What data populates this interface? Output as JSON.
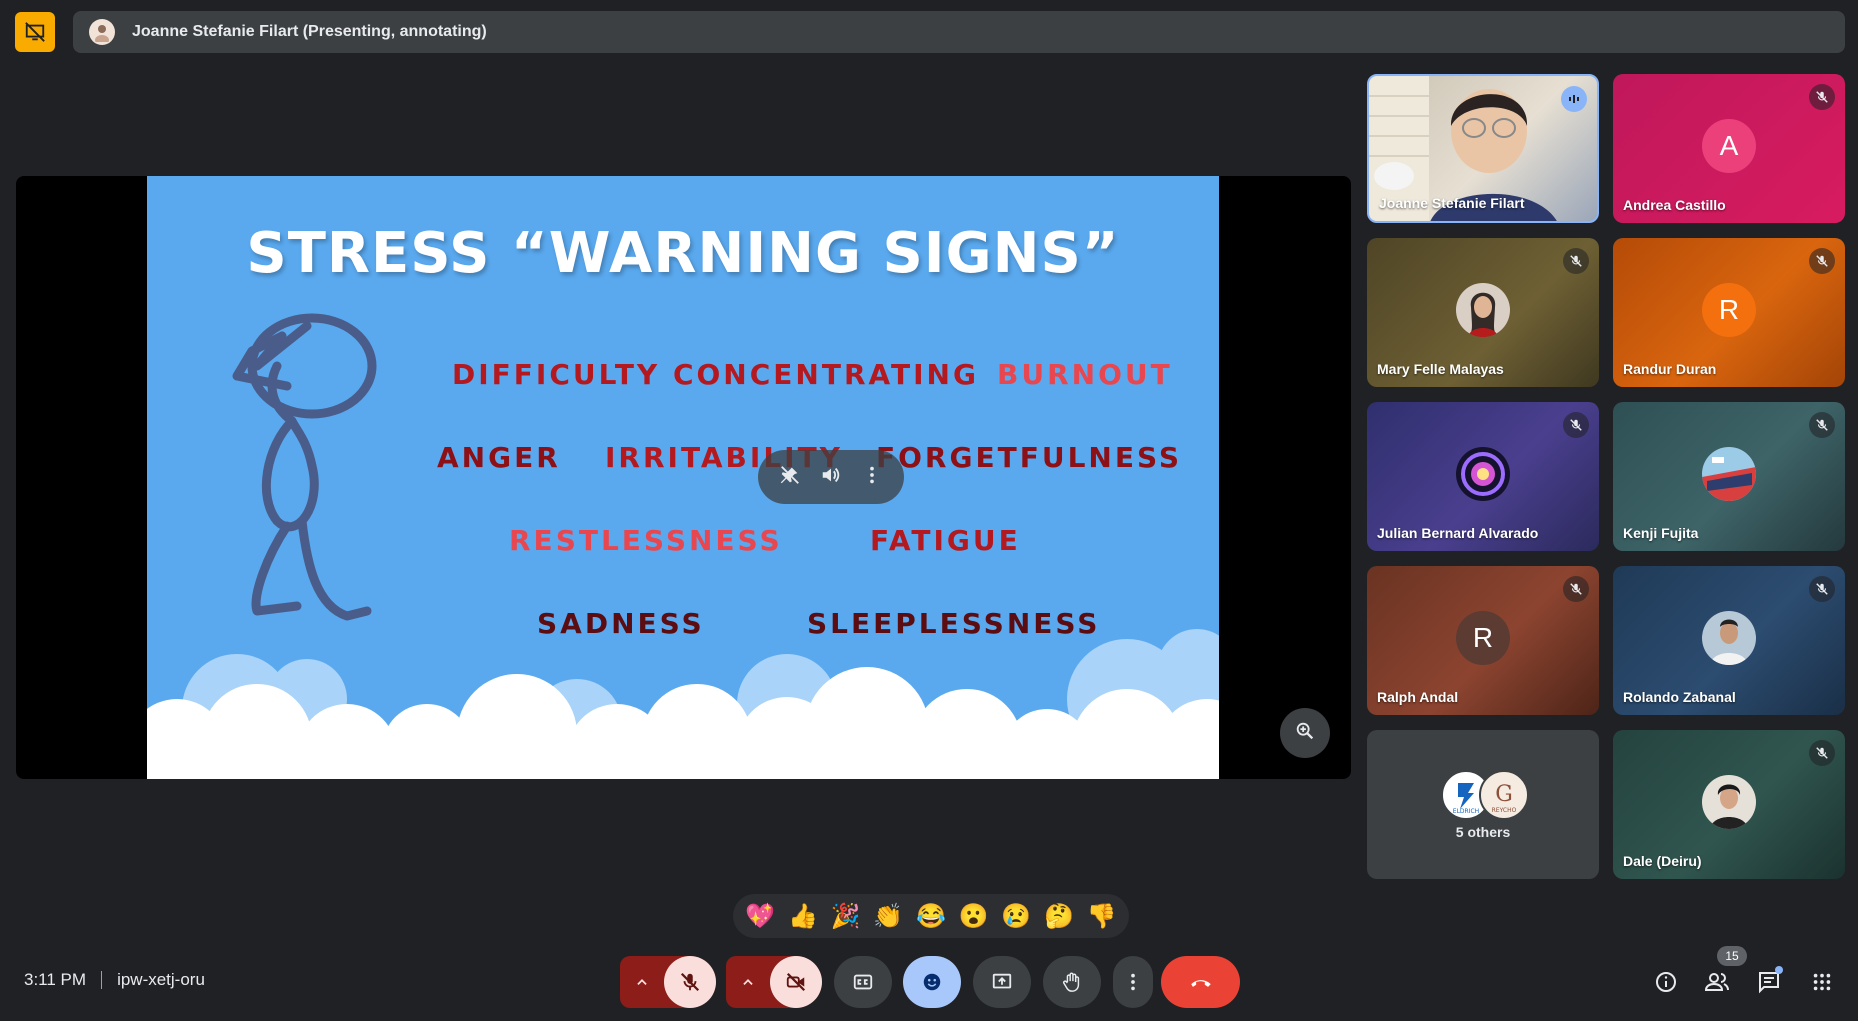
{
  "top_bar": {
    "presenter_text": "Joanne Stefanie Filart (Presenting, annotating)"
  },
  "slide": {
    "title": "STRESS “WARNING SIGNS”",
    "words": [
      {
        "text": "DIFFICULTY CONCENTRATING",
        "color": "#b3191f"
      },
      {
        "text": "BURNOUT",
        "color": "#e8474f"
      },
      {
        "text": "ANGER",
        "color": "#8c1015"
      },
      {
        "text": "IRRITABILITY",
        "color": "#b3191f"
      },
      {
        "text": "FORGETFULNESS",
        "color": "#8c1015"
      },
      {
        "text": "RESTLESSNESS",
        "color": "#e8474f"
      },
      {
        "text": "FATIGUE",
        "color": "#b3191f"
      },
      {
        "text": "SADNESS",
        "color": "#5c0d12"
      },
      {
        "text": "SLEEPLESSNESS",
        "color": "#5c0d12"
      }
    ]
  },
  "participants": [
    {
      "name": "Joanne Stefanie Filart",
      "speaking": true
    },
    {
      "name": "Andrea Castillo",
      "initial": "A",
      "muted": true
    },
    {
      "name": "Mary Felle Malayas",
      "muted": true
    },
    {
      "name": "Randur Duran",
      "initial": "R",
      "muted": true
    },
    {
      "name": "Julian Bernard Alvarado",
      "muted": true
    },
    {
      "name": "Kenji Fujita",
      "muted": true
    },
    {
      "name": "Ralph Andal",
      "initial": "R",
      "muted": true
    },
    {
      "name": "Rolando Zabanal",
      "muted": true
    },
    {
      "others_label": "5 others"
    },
    {
      "name": "Dale (Deiru)",
      "muted": true
    }
  ],
  "others_avatars": [
    "ELDRICH",
    "REYCHO"
  ],
  "reactions": [
    "💖",
    "👍",
    "🎉",
    "👏",
    "😂",
    "😮",
    "😢",
    "🤔",
    "👎"
  ],
  "meeting": {
    "time": "3:11 PM",
    "code": "ipw-xetj-oru"
  },
  "people_count": "15",
  "colors": {
    "background": "#202124",
    "accent_yellow": "#f9ab00",
    "hangup_red": "#ea4335",
    "muted_red": "#f9dedc",
    "reactions_blue": "#a8c7fa"
  }
}
